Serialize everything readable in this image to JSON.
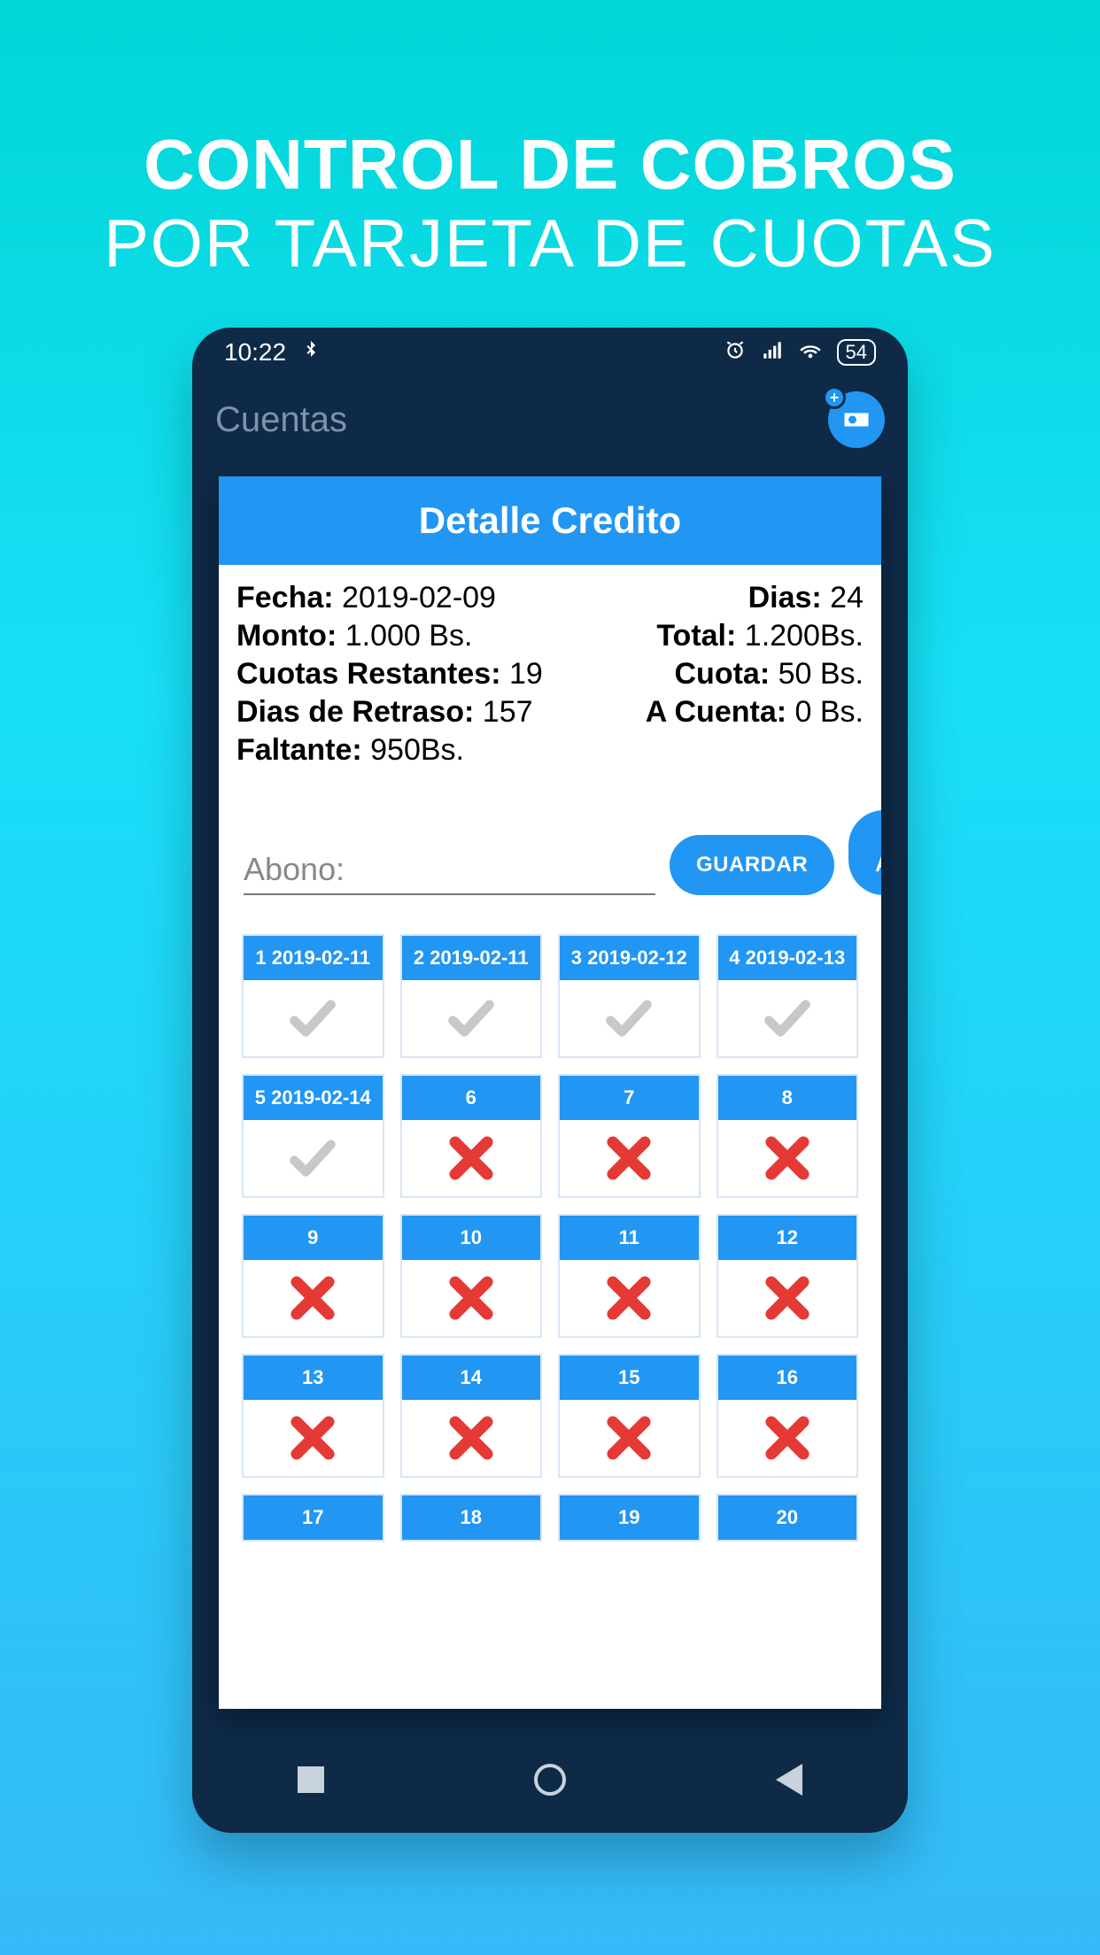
{
  "promo": {
    "line1": "CONTROL DE COBROS",
    "line2": "POR TARJETA DE CUOTAS"
  },
  "statusbar": {
    "time": "10:22",
    "battery": "54"
  },
  "appHeader": {
    "title": "Cuentas"
  },
  "modal": {
    "title": "Detalle Credito",
    "info": {
      "fechaLabel": "Fecha:",
      "fechaValue": "2019-02-09",
      "diasLabel": "Dias:",
      "diasValue": "24",
      "montoLabel": "Monto:",
      "montoValue": "1.000 Bs.",
      "totalLabel": "Total:",
      "totalValue": "1.200Bs.",
      "cuotasRestLabel": "Cuotas Restantes:",
      "cuotasRestValue": "19",
      "cuotaLabel": "Cuota:",
      "cuotaValue": "50 Bs.",
      "diasRetrasoLabel": "Dias de Retraso:",
      "diasRetrasoValue": "157",
      "aCuentaLabel": "A Cuenta:",
      "aCuentaValue": "0 Bs.",
      "faltanteLabel": "Faltante:",
      "faltanteValue": "950Bs."
    },
    "abonoPlaceholder": "Abono:",
    "guardarLabel": "GUARDAR",
    "verAbonosLabel": "VER ABONOS",
    "cells": [
      {
        "header": "1 2019-02-11",
        "status": "paid"
      },
      {
        "header": "2 2019-02-11",
        "status": "paid"
      },
      {
        "header": "3 2019-02-12",
        "status": "paid"
      },
      {
        "header": "4 2019-02-13",
        "status": "paid"
      },
      {
        "header": "5 2019-02-14",
        "status": "paid"
      },
      {
        "header": "6",
        "status": "unpaid"
      },
      {
        "header": "7",
        "status": "unpaid"
      },
      {
        "header": "8",
        "status": "unpaid"
      },
      {
        "header": "9",
        "status": "unpaid"
      },
      {
        "header": "10",
        "status": "unpaid"
      },
      {
        "header": "11",
        "status": "unpaid"
      },
      {
        "header": "12",
        "status": "unpaid"
      },
      {
        "header": "13",
        "status": "unpaid"
      },
      {
        "header": "14",
        "status": "unpaid"
      },
      {
        "header": "15",
        "status": "unpaid"
      },
      {
        "header": "16",
        "status": "unpaid"
      },
      {
        "header": "17",
        "status": "short"
      },
      {
        "header": "18",
        "status": "short"
      },
      {
        "header": "19",
        "status": "short"
      },
      {
        "header": "20",
        "status": "short"
      }
    ]
  }
}
